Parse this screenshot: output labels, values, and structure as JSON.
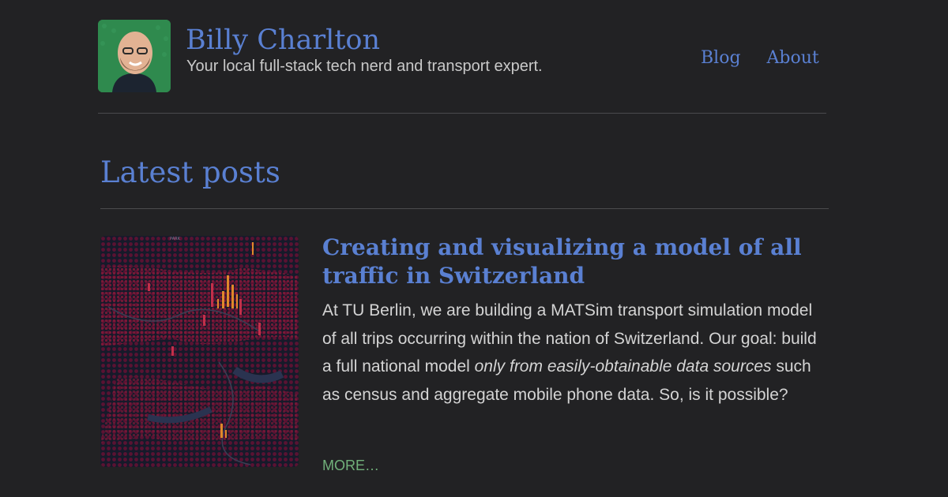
{
  "header": {
    "site_title": "Billy Charlton",
    "tagline": "Your local full-stack tech nerd and transport expert.",
    "avatar_icon": "profile-photo-icon"
  },
  "nav": {
    "items": [
      {
        "label": "Blog"
      },
      {
        "label": "About"
      }
    ]
  },
  "main": {
    "section_title": "Latest posts",
    "posts": [
      {
        "title": "Creating and visualizing a model of all traffic in Switzerland",
        "excerpt_before": "At TU Berlin, we are building a MATSim transport simulation model of all trips occurring within the nation of Switzerland. Our goal: build a full national model ",
        "excerpt_em": "only from easily-obtainable data sources",
        "excerpt_after": " such as census and aggregate mobile phone data. So, is it possible?",
        "more_label": "MORE…",
        "thumbnail_icon": "traffic-map-thumbnail",
        "thumbnail_caption": "PARK"
      }
    ]
  },
  "colors": {
    "background": "#222224",
    "accent": "#5a80d2",
    "more_link": "#71b07a",
    "text": "#d4d4d4"
  }
}
